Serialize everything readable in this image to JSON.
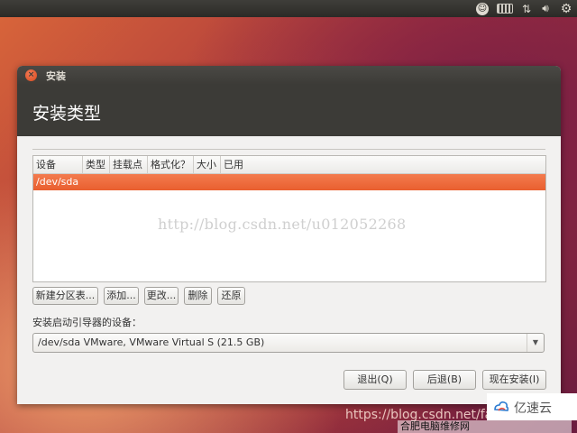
{
  "top_panel": {
    "indicators": [
      "accessibility-icon",
      "keyboard-icon",
      "network-icon",
      "volume-icon",
      "settings-gear-icon"
    ]
  },
  "window": {
    "title": "安装",
    "heading": "安装类型"
  },
  "table": {
    "columns": [
      "设备",
      "类型",
      "挂载点",
      "格式化？",
      "大小",
      "已用"
    ],
    "rows": [
      {
        "device": "/dev/sda"
      }
    ],
    "selected_row_color": "#ef6b3b"
  },
  "buttons": {
    "new_table": "新建分区表...",
    "add": "添加...",
    "change": "更改...",
    "delete": "删除",
    "revert": "还原"
  },
  "bootloader": {
    "label": "安装启动引导器的设备：",
    "value": "/dev/sda  VMware, VMware Virtual S (21.5 GB)"
  },
  "actions": {
    "quit": "退出(Q)",
    "back": "后退(B)",
    "install": "现在安装(I)"
  },
  "watermarks": {
    "center": "http://blog.csdn.net/u012052268",
    "bottom": "https://blog.csdn.net/fa",
    "logo_text": "亿速云",
    "caption": "合肥电脑维修网"
  },
  "colors": {
    "accent": "#e95f2f",
    "header": "#3c3b37"
  }
}
